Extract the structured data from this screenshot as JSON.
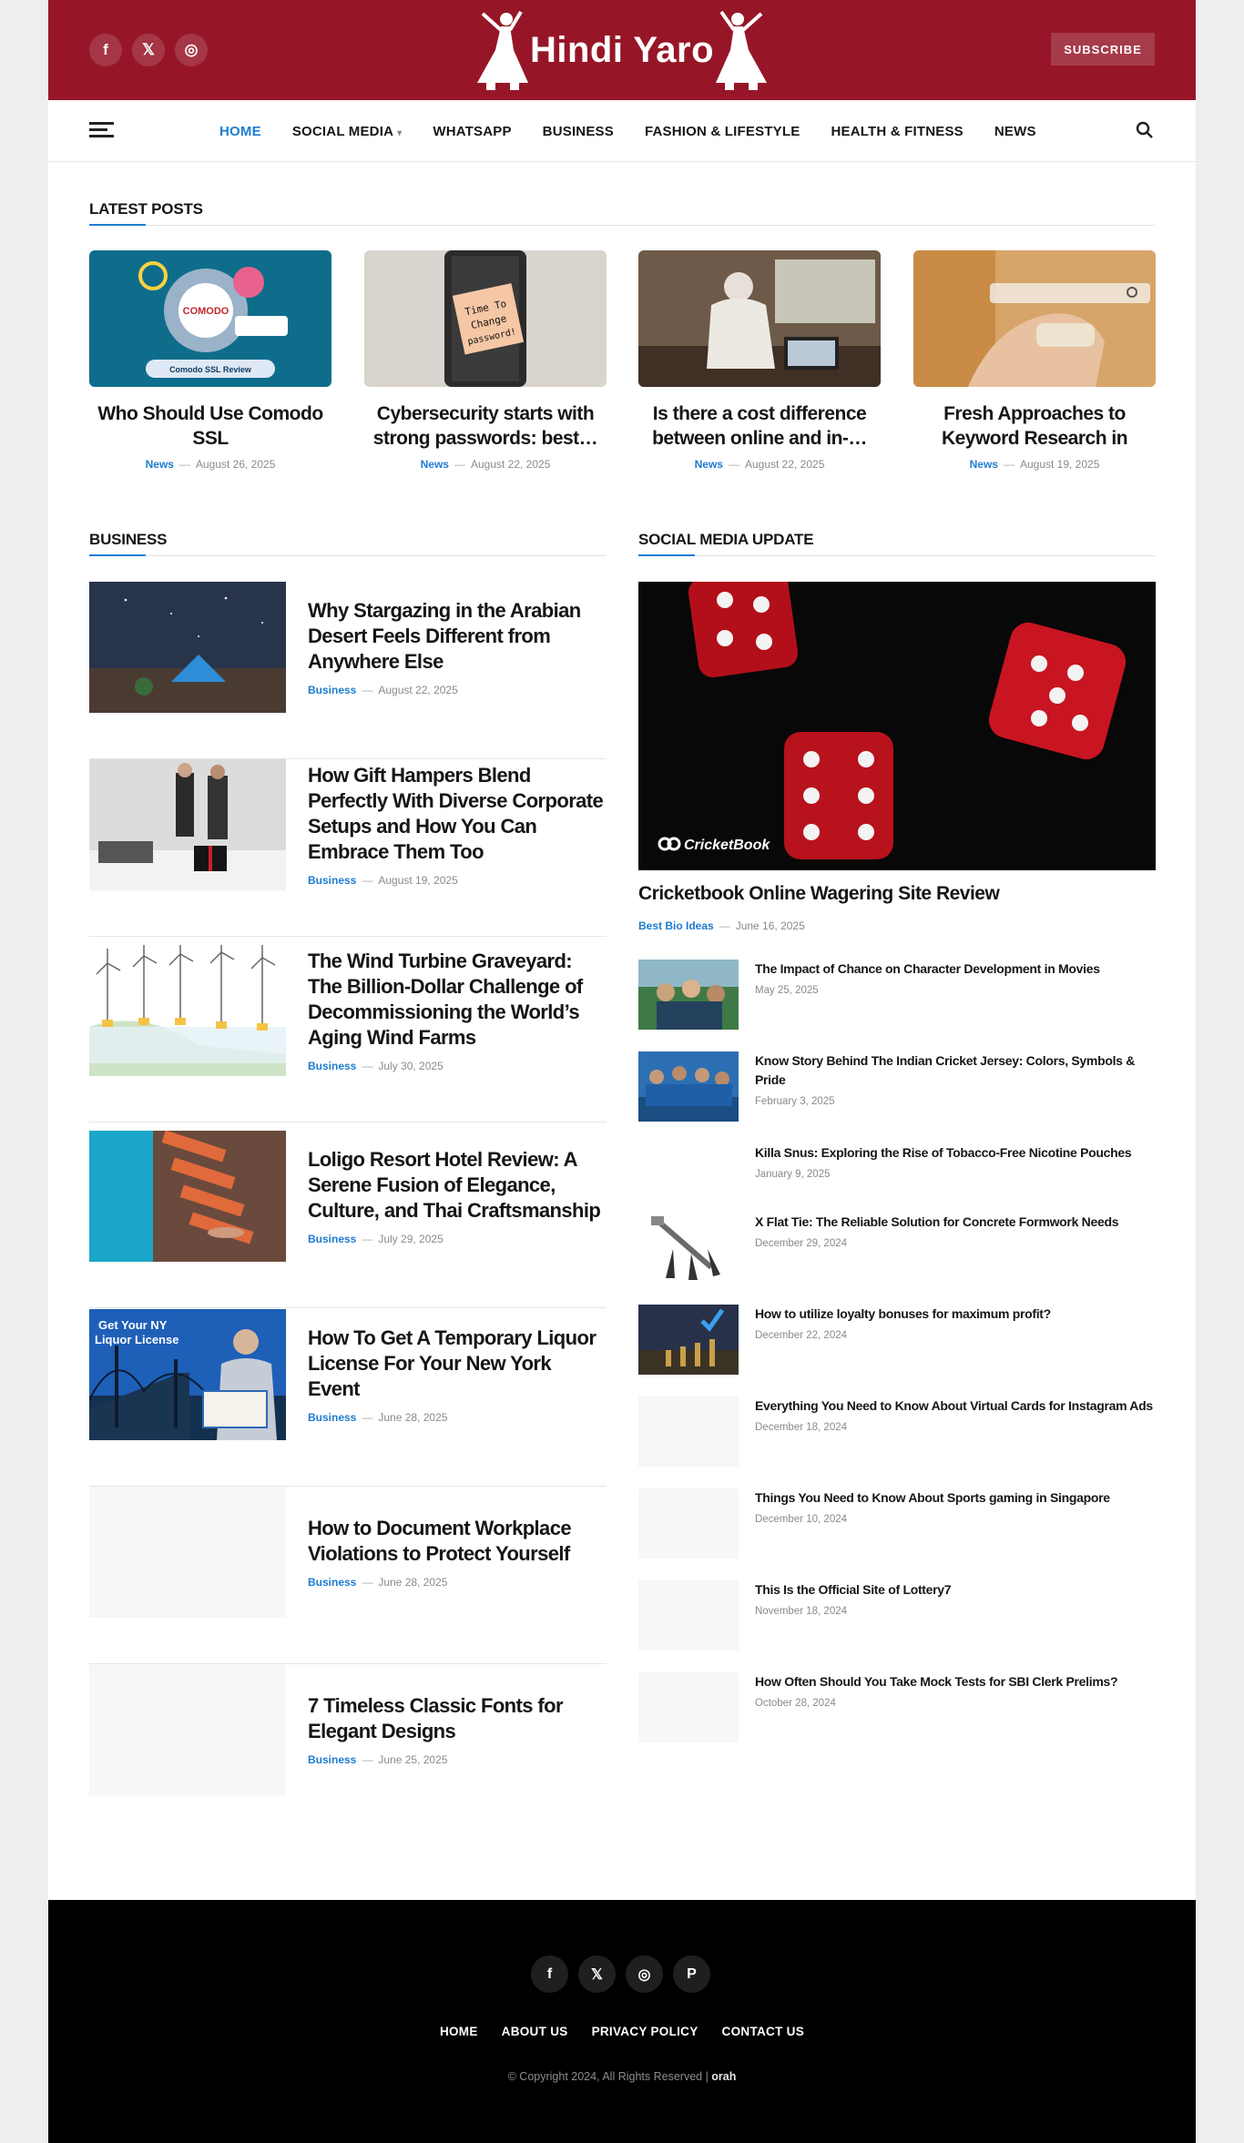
{
  "header": {
    "logo": "Hindi Yaro",
    "subscribe": "SUBSCRIBE",
    "social": [
      {
        "icon": "facebook-icon",
        "glyph": "f"
      },
      {
        "icon": "x-icon",
        "glyph": "𝕏"
      },
      {
        "icon": "instagram-icon",
        "glyph": "◎"
      }
    ]
  },
  "nav": {
    "items": [
      "HOME",
      "SOCIAL MEDIA",
      "WHATSAPP",
      "BUSINESS",
      "FASHION & LIFESTYLE",
      "HEALTH & FITNESS",
      "NEWS"
    ],
    "active": "HOME"
  },
  "latest": {
    "heading": "LATEST POSTS",
    "posts": [
      {
        "title": "Who Should Use Comodo SSL",
        "cat": "News",
        "date": "August 26, 2025"
      },
      {
        "title": "Cybersecurity starts with strong passwords: best…",
        "cat": "News",
        "date": "August 22, 2025"
      },
      {
        "title": "Is there a cost difference between online and in-…",
        "cat": "News",
        "date": "August 22, 2025"
      },
      {
        "title": "Fresh Approaches to Keyword Research in Modern Digital…",
        "cat": "News",
        "date": "August 19, 2025"
      }
    ],
    "thumb_texts": {
      "comodo_badge": "COMODO",
      "comodo_label": "Comodo SSL Review",
      "password_note": "Time To Change password!"
    }
  },
  "business": {
    "heading": "BUSINESS",
    "posts": [
      {
        "title": "Why Stargazing in the Arabian Desert Feels Different from Anywhere Else",
        "cat": "Business",
        "date": "August 22, 2025"
      },
      {
        "title": "How Gift Hampers Blend Perfectly With Diverse Corporate Setups and How You Can Embrace Them Too",
        "cat": "Business",
        "date": "August 19, 2025"
      },
      {
        "title": "The Wind Turbine Graveyard: The Billion-Dollar Challenge of Decommissioning the World’s Aging Wind Farms",
        "cat": "Business",
        "date": "July 30, 2025"
      },
      {
        "title": "Loligo Resort Hotel Review: A Serene Fusion of Elegance, Culture, and Thai Craftsmanship",
        "cat": "Business",
        "date": "July 29, 2025"
      },
      {
        "title": "How To Get A Temporary Liquor License For Your New York Event",
        "cat": "Business",
        "date": "June 28, 2025"
      },
      {
        "title": "How to Document Workplace Violations to Protect Yourself",
        "cat": "Business",
        "date": "June 28, 2025"
      },
      {
        "title": "7 Timeless Classic Fonts for Elegant Designs",
        "cat": "Business",
        "date": "June 25, 2025"
      }
    ],
    "liquor_thumb_text": "Get Your NY Liquor License"
  },
  "social_media": {
    "heading": "SOCIAL MEDIA UPDATE",
    "featured": {
      "title": "Cricketbook Online Wagering Site Review",
      "cat": "Best Bio Ideas",
      "date": "June 16, 2025",
      "watermark": "CricketBook"
    },
    "items": [
      {
        "title": "The Impact of Chance on Character Development in Movies",
        "date": "May 25, 2025"
      },
      {
        "title": "Know Story Behind The Indian Cricket Jersey: Colors, Symbols & Pride",
        "date": "February 3, 2025"
      },
      {
        "title": "Killa Snus: Exploring the Rise of Tobacco-Free Nicotine Pouches",
        "date": "January 9, 2025"
      },
      {
        "title": "X Flat Tie: The Reliable Solution for Concrete Formwork Needs",
        "date": "December 29, 2024"
      },
      {
        "title": "How to utilize loyalty bonuses for maximum profit?",
        "date": "December 22, 2024"
      },
      {
        "title": "Everything You Need to Know About Virtual Cards for Instagram Ads",
        "date": "December 18, 2024"
      },
      {
        "title": "Things You Need to Know About Sports gaming in Singapore",
        "date": "December 10, 2024"
      },
      {
        "title": "This Is the Official Site of Lottery7",
        "date": "November 18, 2024"
      },
      {
        "title": "How Often Should You Take Mock Tests for SBI Clerk Prelims?",
        "date": "October 28, 2024"
      }
    ]
  },
  "footer": {
    "social": [
      {
        "icon": "facebook-icon",
        "glyph": "f"
      },
      {
        "icon": "x-icon",
        "glyph": "𝕏"
      },
      {
        "icon": "instagram-icon",
        "glyph": "◎"
      },
      {
        "icon": "pinterest-icon",
        "glyph": "P"
      }
    ],
    "links": [
      "HOME",
      "ABOUT US",
      "PRIVACY POLICY",
      "CONTACT US"
    ],
    "copyright": "© Copyright 2024, All Rights Reserved | ",
    "copyright_brand": "orah"
  },
  "colors": {
    "brand": "#961628",
    "accent": "#1e7cd0",
    "footer": "#000000"
  }
}
